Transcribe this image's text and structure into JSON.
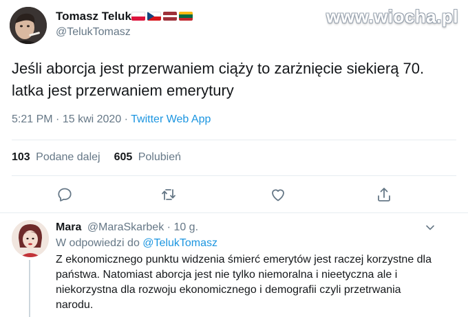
{
  "watermark": "www.wiocha.pl",
  "tweet": {
    "author_name": "Tomasz Teluk",
    "author_handle": "@TelukTomasz",
    "flags": [
      "poland-flag",
      "czech-flag",
      "latvia-flag",
      "lithuania-flag"
    ],
    "text": "Jeśli aborcja jest przerwaniem ciąży to zarżnięcie siekierą 70. latka jest przerwaniem emerytury",
    "time": "5:21 PM",
    "date": "15 kwi 2020",
    "separator": "·",
    "app": "Twitter Web App",
    "retweets_count": "103",
    "retweets_label": "Podane dalej",
    "likes_count": "605",
    "likes_label": "Polubień"
  },
  "actions": [
    "reply-icon",
    "retweet-icon",
    "like-icon",
    "share-icon"
  ],
  "reply": {
    "name": "Mara",
    "handle": "@MaraSkarbek",
    "dot": "·",
    "age": "10 g.",
    "reply_to_label": "W odpowiedzi do",
    "reply_to_handle": "@TelukTomasz",
    "text": "Z ekonomicznego punktu widzenia śmierć emerytów jest raczej korzystne dla państwa. Natomiast aborcja jest nie tylko niemoralna i nieetyczna ale i niekorzystna dla rozwoju ekonomicznego i demografii czyli przetrwania narodu."
  },
  "colors": {
    "accent": "#1b95e0",
    "secondary_text": "#657786",
    "primary_text": "#14171a",
    "divider": "#e6ecf0"
  }
}
